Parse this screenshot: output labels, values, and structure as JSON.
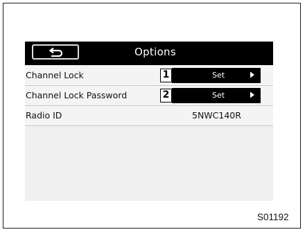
{
  "header": {
    "title": "Options",
    "back_icon": "back-arrow-icon"
  },
  "rows": [
    {
      "label": "Channel Lock",
      "callout": "1",
      "button_label": "Set"
    },
    {
      "label": "Channel Lock Password",
      "callout": "2",
      "button_label": "Set"
    },
    {
      "label": "Radio ID",
      "value": "5NWC140R"
    }
  ],
  "figure_code": "S01192",
  "colors": {
    "header_bg": "#000000",
    "screen_bg": "#f0f0f0",
    "button_bg": "#000000"
  }
}
